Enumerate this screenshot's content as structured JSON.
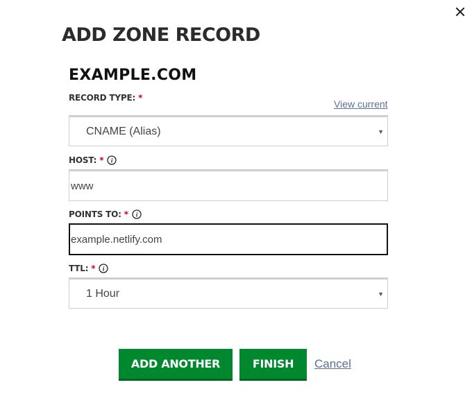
{
  "dialog": {
    "title": "ADD ZONE RECORD",
    "domain": "EXAMPLE.COM",
    "close_icon": "close-icon"
  },
  "form": {
    "record_type": {
      "label": "RECORD TYPE:",
      "required_mark": "*",
      "value": "CNAME (Alias)",
      "view_current_link": "View current"
    },
    "host": {
      "label": "HOST:",
      "required_mark": "*",
      "value": "www",
      "info_icon": "info-icon"
    },
    "points_to": {
      "label": "POINTS TO:",
      "required_mark": "*",
      "value": "example.netlify.com",
      "info_icon": "info-icon"
    },
    "ttl": {
      "label": "TTL:",
      "required_mark": "*",
      "value": "1 Hour",
      "info_icon": "info-icon"
    }
  },
  "actions": {
    "add_another": "ADD ANOTHER",
    "finish": "FINISH",
    "cancel": "Cancel"
  },
  "colors": {
    "primary_button": "#00882e",
    "required": "#d0021b",
    "link": "#5a6f99"
  }
}
